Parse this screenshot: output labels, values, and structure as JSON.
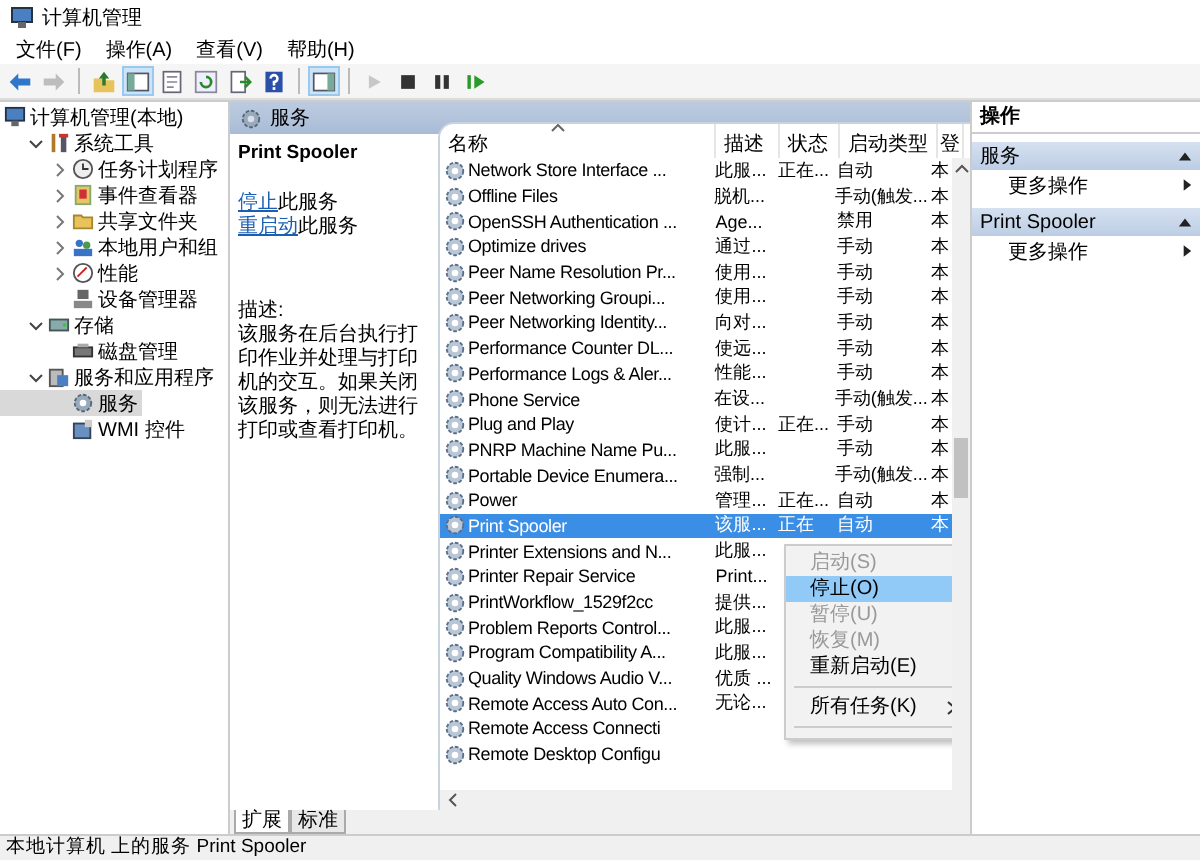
{
  "window": {
    "title": "计算机管理"
  },
  "menu": [
    "文件(F)",
    "操作(A)",
    "查看(V)",
    "帮助(H)"
  ],
  "toolbar": [
    {
      "disabled": false,
      "pressed": false
    },
    {
      "disabled": true,
      "pressed": false
    },
    {
      "disabled": false,
      "pressed": false
    },
    {
      "disabled": false,
      "pressed": true
    },
    {
      "disabled": false,
      "pressed": false
    },
    {
      "disabled": false,
      "pressed": false
    },
    {
      "disabled": false,
      "pressed": false
    },
    {
      "disabled": false,
      "pressed": false
    },
    {
      "disabled": false,
      "pressed": true
    },
    {
      "disabled": true,
      "pressed": false
    },
    {
      "disabled": false,
      "pressed": false
    },
    {
      "disabled": false,
      "pressed": false
    },
    {
      "disabled": false,
      "pressed": false
    }
  ],
  "tree": {
    "label": "计算机管理(本地)",
    "selected": false,
    "children": [
      {
        "label": "系统工具",
        "selected": false,
        "expanded": true,
        "children": [
          {
            "label": "任务计划程序",
            "selected": false,
            "expanded": false
          },
          {
            "label": "事件查看器",
            "selected": false,
            "expanded": false
          },
          {
            "label": "共享文件夹",
            "selected": false,
            "expanded": false
          },
          {
            "label": "本地用户和组",
            "selected": false,
            "expanded": false
          },
          {
            "label": "性能",
            "selected": false,
            "expanded": false
          },
          {
            "label": "设备管理器",
            "selected": false
          }
        ]
      },
      {
        "label": "存储",
        "selected": false,
        "expanded": true,
        "children": [
          {
            "label": "磁盘管理",
            "selected": false
          }
        ]
      },
      {
        "label": "服务和应用程序",
        "selected": false,
        "expanded": true,
        "children": [
          {
            "label": "服务",
            "selected": true
          },
          {
            "label": "WMI 控件",
            "selected": false
          }
        ]
      }
    ]
  },
  "panel_header": "服务",
  "details": {
    "title": "Print Spooler",
    "actions": [
      {
        "link": "停止",
        "text": "此服务"
      },
      {
        "link": "重启动",
        "text": "此服务"
      }
    ],
    "description_label": "描述:",
    "description": "该服务在后台执行打印作业并处理与打印机的交互。如果关闭该服务，则无法进行打印或查看打印机。"
  },
  "list": {
    "columns": [
      {
        "label": "名称",
        "sorted": true
      },
      {
        "label": "描述",
        "sorted": false
      },
      {
        "label": "状态",
        "sorted": false
      },
      {
        "label": "启动类型",
        "sorted": false
      },
      {
        "label": "登",
        "sorted": false
      }
    ],
    "rows": [
      {
        "name": "Network Store Interface ...",
        "desc": "此服...",
        "status": "正在...",
        "startup": "自动",
        "column_5": "本",
        "selected": false
      },
      {
        "name": "Offline Files",
        "desc": "脱机...",
        "startup": "手动(触发...",
        "column_5": "本",
        "selected": false
      },
      {
        "name": "OpenSSH Authentication ...",
        "desc": "Age...",
        "startup": "禁用",
        "column_5": "本",
        "selected": false
      },
      {
        "name": "Optimize drives",
        "desc": "通过...",
        "startup": "手动",
        "column_5": "本",
        "selected": false
      },
      {
        "name": "Peer Name Resolution Pr...",
        "desc": "使用...",
        "startup": "手动",
        "column_5": "本",
        "selected": false
      },
      {
        "name": "Peer Networking Groupi...",
        "desc": "使用...",
        "startup": "手动",
        "column_5": "本",
        "selected": false
      },
      {
        "name": "Peer Networking Identity...",
        "desc": "向对...",
        "startup": "手动",
        "column_5": "本",
        "selected": false
      },
      {
        "name": "Performance Counter DL...",
        "desc": "使远...",
        "startup": "手动",
        "column_5": "本",
        "selected": false
      },
      {
        "name": "Performance Logs & Aler...",
        "desc": "性能...",
        "startup": "手动",
        "column_5": "本",
        "selected": false
      },
      {
        "name": "Phone Service",
        "desc": "在设...",
        "startup": "手动(触发...",
        "column_5": "本",
        "selected": false
      },
      {
        "name": "Plug and Play",
        "desc": "使计...",
        "status": "正在...",
        "startup": "手动",
        "column_5": "本",
        "selected": false
      },
      {
        "name": "PNRP Machine Name Pu...",
        "desc": "此服...",
        "startup": "手动",
        "column_5": "本",
        "selected": false
      },
      {
        "name": "Portable Device Enumera...",
        "desc": "强制...",
        "startup": "手动(触发...",
        "column_5": "本",
        "selected": false
      },
      {
        "name": "Power",
        "desc": "管理...",
        "status": "正在...",
        "startup": "自动",
        "column_5": "本",
        "selected": false
      },
      {
        "name": "Print Spooler",
        "desc": "该服...",
        "status": "正在",
        "startup": "自动",
        "column_5": "本",
        "selected": true
      },
      {
        "name": "Printer Extensions and N...",
        "desc": "此服...",
        "selected": false
      },
      {
        "name": "Printer Repair Service",
        "desc": "Print...",
        "selected": false
      },
      {
        "name": "PrintWorkflow_1529f2cc",
        "desc": "提供...",
        "selected": false
      },
      {
        "name": "Problem Reports Control...",
        "desc": "此服...",
        "selected": false
      },
      {
        "name": "Program Compatibility A...",
        "desc": "此服...",
        "selected": false
      },
      {
        "name": "Quality Windows Audio V...",
        "desc": "优质 ...",
        "selected": false
      },
      {
        "name": "Remote Access Auto Con...",
        "desc": "无论...",
        "selected": false
      },
      {
        "name": "Remote Access Connecti",
        "selected": false
      },
      {
        "name": "Remote Desktop Configu",
        "selected": false
      }
    ]
  },
  "context_menu": [
    {
      "kind": "item",
      "label": "启动(S)",
      "disabled": true,
      "selected": false
    },
    {
      "kind": "item",
      "label": "停止(O)",
      "disabled": false,
      "selected": true
    },
    {
      "kind": "item",
      "label": "暂停(U)",
      "disabled": true,
      "selected": false
    },
    {
      "kind": "item",
      "label": "恢复(M)",
      "disabled": true,
      "selected": false
    },
    {
      "kind": "item",
      "label": "重新启动(E)",
      "disabled": false,
      "selected": false
    },
    {
      "kind": "separator"
    },
    {
      "kind": "submenu",
      "label": "所有任务(K)",
      "disabled": false,
      "selected": false
    },
    {
      "kind": "separator"
    }
  ],
  "tabs": [
    {
      "label": "扩展",
      "selected": true
    },
    {
      "label": "标准",
      "selected": false
    }
  ],
  "actions_pane": {
    "title": "操作",
    "sections": [
      {
        "title": "服务",
        "expanded": true,
        "items": [
          "更多操作"
        ]
      },
      {
        "title": "Print Spooler",
        "expanded": true,
        "items": [
          "更多操作"
        ]
      }
    ]
  },
  "status_bar": "本地计算机 上的服务 Print Spooler"
}
